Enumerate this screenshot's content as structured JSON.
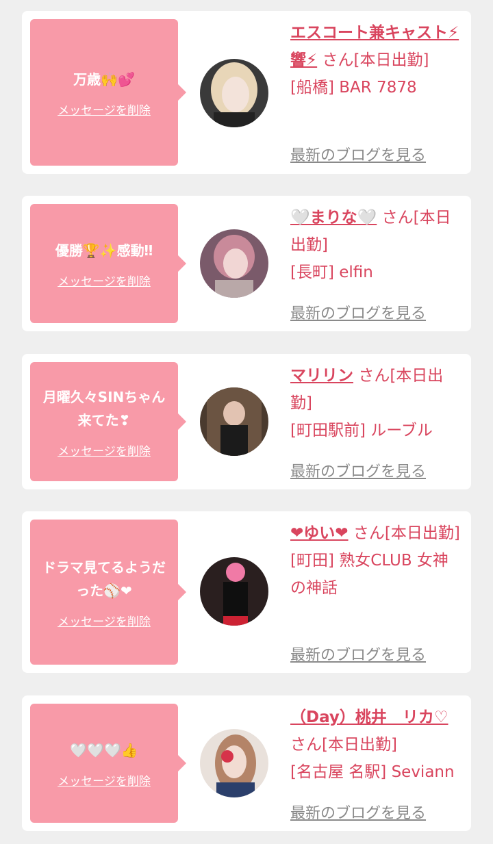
{
  "delete_label": "メッセージを削除",
  "blog_label": "最新のブログを見る",
  "san_label": "さん[本日出勤]",
  "cards": [
    {
      "message": "万歳🙌💕",
      "name": "エスコート兼キャスト⚡響⚡",
      "area": "[船橋] BAR 7878",
      "avatar": "avatar-blonde-woman"
    },
    {
      "message": "優勝🏆✨感動‼",
      "name": "🤍まりな🤍",
      "area": "[長町] elfin",
      "avatar": "avatar-pink-hair-woman"
    },
    {
      "message": "月曜久々SINちゃん来てた❣",
      "name": "マリリン",
      "area": "[町田駅前] ルーブル",
      "avatar": "avatar-mirror-selfie"
    },
    {
      "message": "ドラマ見てるようだった⚾❤",
      "name": "❤ゆい❤",
      "area": "[町田] 熟女CLUB 女神の神話",
      "avatar": "avatar-dress-photo"
    },
    {
      "message": "🤍🤍🤍👍",
      "name": "（Day）桃井　リカ♡",
      "area": "[名古屋 名駅] Seviann",
      "avatar": "avatar-red-flower-woman"
    }
  ],
  "colors": {
    "bubble": "#f89aa8",
    "accent": "#d9455e",
    "link_gray": "#8a8a8a",
    "background": "#efefef"
  }
}
